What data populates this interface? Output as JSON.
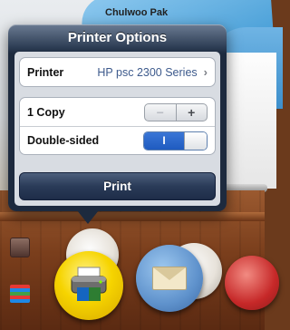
{
  "background": {
    "device_name": "Chulwoo Pak"
  },
  "popover": {
    "title": "Printer Options",
    "printer": {
      "label": "Printer",
      "value": "HP psc 2300 Series"
    },
    "copies": {
      "label": "1 Copy",
      "minus": "−",
      "plus": "+"
    },
    "double_sided": {
      "label": "Double-sided",
      "state": "I",
      "on": true
    },
    "print_label": "Print"
  },
  "dock": {
    "items": [
      "books-icon",
      "printer-icon",
      "mail-icon",
      "book-icon"
    ]
  }
}
